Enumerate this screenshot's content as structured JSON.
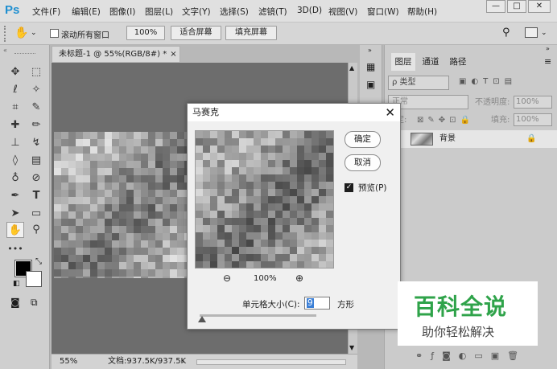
{
  "app": {
    "logo": "Ps"
  },
  "menu": [
    "文件(F)",
    "编辑(E)",
    "图像(I)",
    "图层(L)",
    "文字(Y)",
    "选择(S)",
    "滤镜(T)",
    "3D(D)",
    "视图(V)",
    "窗口(W)",
    "帮助(H)"
  ],
  "window_controls": {
    "minimize": "—",
    "restore": "□",
    "close": "✕"
  },
  "options": {
    "scroll_all_label": "滚动所有窗口",
    "zoom_100_label": "100%",
    "fit_screen_label": "适合屏幕",
    "fill_screen_label": "填充屏幕"
  },
  "document": {
    "tab_title": "未标题-1 @ 55%(RGB/8#) *",
    "tab_close": "×",
    "status_zoom": "55%",
    "status_doc": "文档:937.5K/937.5K"
  },
  "panels": {
    "tabs": [
      "图层",
      "通道",
      "路径"
    ],
    "kind_label": "ρ 类型",
    "blend_mode": "正常",
    "opacity_label": "不透明度:",
    "opacity_value": "100%",
    "lock_label": "锁定:",
    "fill_label": "填充:",
    "fill_value": "100%",
    "layer_name": "背景"
  },
  "dialog": {
    "title": "马赛克",
    "ok_label": "确定",
    "cancel_label": "取消",
    "preview_label": "预览(P)",
    "preview_checked": true,
    "zoom_value": "100%",
    "cell_size_label": "单元格大小(C):",
    "cell_size_value": "9",
    "cell_size_unit": "方形",
    "slider_level": 0.02
  },
  "watermark": {
    "title": "百科全说",
    "subtitle": "助你轻松解决"
  },
  "colors": {
    "accent": "#1f8fd0",
    "watermark_green": "#2fa34a",
    "dialog_bg": "#f0f0f0"
  }
}
